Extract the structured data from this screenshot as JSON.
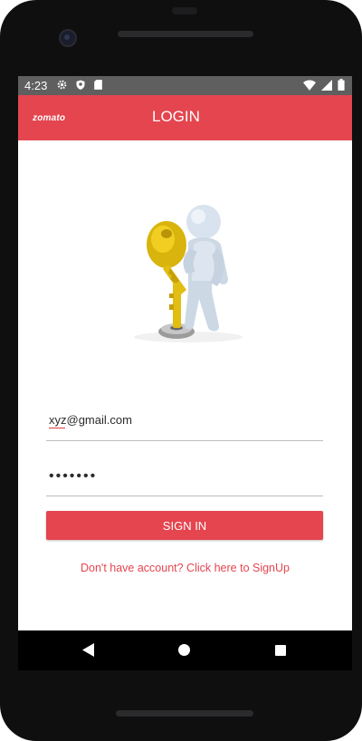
{
  "status_bar": {
    "time": "4:23",
    "left_icons": [
      "settings-icon",
      "shield-icon",
      "sd-card-icon"
    ],
    "right_icons": [
      "wifi-icon",
      "signal-icon",
      "battery-icon"
    ]
  },
  "app_bar": {
    "brand": "zomato",
    "title": "LOGIN",
    "color": "#e4454f"
  },
  "illustration": {
    "icon": "person-with-key-icon"
  },
  "form": {
    "email_value": "xyz@gmail.com",
    "password_value": "•••••••",
    "sign_in_label": "SIGN IN",
    "signup_link": "Don't have account? Click here to SignUp"
  },
  "nav_bar": {
    "icons": [
      "back-icon",
      "home-icon",
      "recents-icon"
    ]
  }
}
